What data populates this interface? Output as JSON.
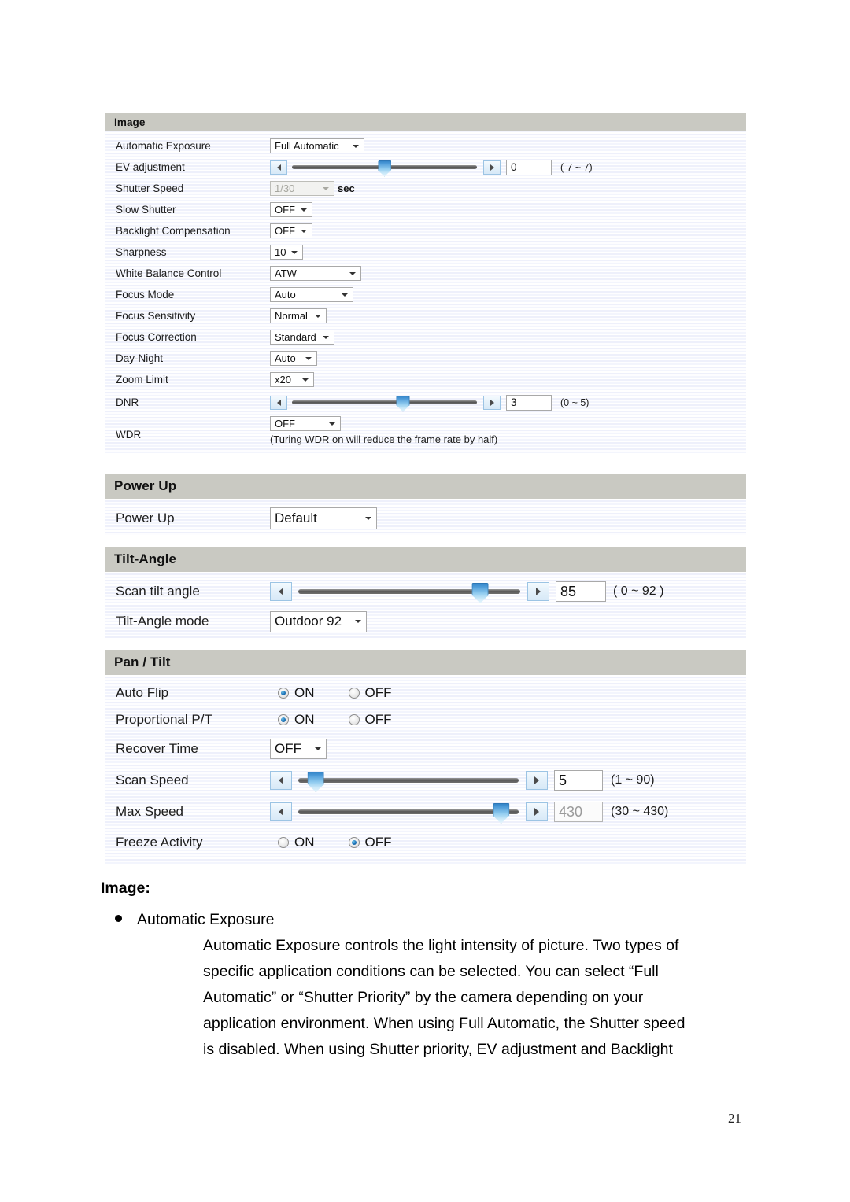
{
  "page": {
    "number": "21"
  },
  "image_panel": {
    "title": "Image",
    "rows": {
      "automatic_exposure": {
        "label": "Automatic Exposure",
        "value": "Full Automatic"
      },
      "ev_adjustment": {
        "label": "EV adjustment",
        "value": "0",
        "range": "(-7 ~ 7)",
        "min": -7,
        "max": 7,
        "percent": 50
      },
      "shutter_speed": {
        "label": "Shutter Speed",
        "value": "1/30",
        "unit": "sec",
        "disabled": true
      },
      "slow_shutter": {
        "label": "Slow Shutter",
        "value": "OFF"
      },
      "backlight_compensation": {
        "label": "Backlight Compensation",
        "value": "OFF"
      },
      "sharpness": {
        "label": "Sharpness",
        "value": "10"
      },
      "white_balance_control": {
        "label": "White Balance Control",
        "value": "ATW"
      },
      "focus_mode": {
        "label": "Focus Mode",
        "value": "Auto"
      },
      "focus_sensitivity": {
        "label": "Focus Sensitivity",
        "value": "Normal"
      },
      "focus_correction": {
        "label": "Focus Correction",
        "value": "Standard"
      },
      "day_night": {
        "label": "Day-Night",
        "value": "Auto"
      },
      "zoom_limit": {
        "label": "Zoom Limit",
        "value": "x20"
      },
      "dnr": {
        "label": "DNR",
        "value": "3",
        "range": "(0 ~ 5)",
        "min": 0,
        "max": 5,
        "percent": 60
      },
      "wdr": {
        "label": "WDR",
        "value": "OFF",
        "note": "(Turing WDR on will reduce the frame rate by half)"
      }
    }
  },
  "power_up_panel": {
    "title": "Power Up",
    "rows": {
      "power_up": {
        "label": "Power Up",
        "value": "Default"
      }
    }
  },
  "tilt_angle_panel": {
    "title": "Tilt-Angle",
    "rows": {
      "scan_tilt_angle": {
        "label": "Scan tilt angle",
        "value": "85",
        "range": "( 0 ~ 92 )",
        "min": 0,
        "max": 92,
        "percent": 82
      },
      "tilt_angle_mode": {
        "label": "Tilt-Angle mode",
        "value": "Outdoor 92"
      }
    }
  },
  "pan_tilt_panel": {
    "title": "Pan / Tilt",
    "rows": {
      "auto_flip": {
        "label": "Auto Flip",
        "on_label": "ON",
        "off_label": "OFF",
        "selected": "ON"
      },
      "proportional_pt": {
        "label": "Proportional P/T",
        "on_label": "ON",
        "off_label": "OFF",
        "selected": "ON"
      },
      "recover_time": {
        "label": "Recover Time",
        "value": "OFF"
      },
      "scan_speed": {
        "label": "Scan Speed",
        "value": "5",
        "range": "(1 ~ 90)",
        "min": 1,
        "max": 90,
        "percent": 8
      },
      "max_speed": {
        "label": "Max Speed",
        "value": "430",
        "range": "(30 ~ 430)",
        "min": 30,
        "max": 430,
        "percent": 92,
        "disabled": true
      },
      "freeze_activity": {
        "label": "Freeze Activity",
        "on_label": "ON",
        "off_label": "OFF",
        "selected": "OFF"
      }
    }
  },
  "description": {
    "heading": "Image:",
    "bullet": "Automatic Exposure",
    "lines": [
      "Automatic Exposure controls the light intensity of picture. Two types of",
      "specific application conditions can be selected. You can select “Full",
      "Automatic” or “Shutter Priority” by the camera depending on your",
      "application environment. When using Full Automatic, the Shutter speed",
      "is disabled. When using Shutter priority, EV adjustment and Backlight"
    ]
  }
}
